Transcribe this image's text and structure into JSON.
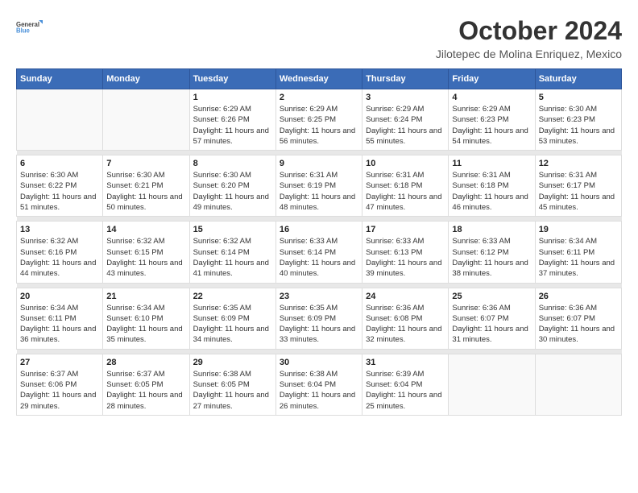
{
  "header": {
    "logo_line1": "General",
    "logo_line2": "Blue",
    "month_title": "October 2024",
    "location": "Jilotepec de Molina Enriquez, Mexico"
  },
  "weekdays": [
    "Sunday",
    "Monday",
    "Tuesday",
    "Wednesday",
    "Thursday",
    "Friday",
    "Saturday"
  ],
  "weeks": [
    [
      {
        "day": "",
        "sunrise": "",
        "sunset": "",
        "daylight": ""
      },
      {
        "day": "",
        "sunrise": "",
        "sunset": "",
        "daylight": ""
      },
      {
        "day": "1",
        "sunrise": "Sunrise: 6:29 AM",
        "sunset": "Sunset: 6:26 PM",
        "daylight": "Daylight: 11 hours and 57 minutes."
      },
      {
        "day": "2",
        "sunrise": "Sunrise: 6:29 AM",
        "sunset": "Sunset: 6:25 PM",
        "daylight": "Daylight: 11 hours and 56 minutes."
      },
      {
        "day": "3",
        "sunrise": "Sunrise: 6:29 AM",
        "sunset": "Sunset: 6:24 PM",
        "daylight": "Daylight: 11 hours and 55 minutes."
      },
      {
        "day": "4",
        "sunrise": "Sunrise: 6:29 AM",
        "sunset": "Sunset: 6:23 PM",
        "daylight": "Daylight: 11 hours and 54 minutes."
      },
      {
        "day": "5",
        "sunrise": "Sunrise: 6:30 AM",
        "sunset": "Sunset: 6:23 PM",
        "daylight": "Daylight: 11 hours and 53 minutes."
      }
    ],
    [
      {
        "day": "6",
        "sunrise": "Sunrise: 6:30 AM",
        "sunset": "Sunset: 6:22 PM",
        "daylight": "Daylight: 11 hours and 51 minutes."
      },
      {
        "day": "7",
        "sunrise": "Sunrise: 6:30 AM",
        "sunset": "Sunset: 6:21 PM",
        "daylight": "Daylight: 11 hours and 50 minutes."
      },
      {
        "day": "8",
        "sunrise": "Sunrise: 6:30 AM",
        "sunset": "Sunset: 6:20 PM",
        "daylight": "Daylight: 11 hours and 49 minutes."
      },
      {
        "day": "9",
        "sunrise": "Sunrise: 6:31 AM",
        "sunset": "Sunset: 6:19 PM",
        "daylight": "Daylight: 11 hours and 48 minutes."
      },
      {
        "day": "10",
        "sunrise": "Sunrise: 6:31 AM",
        "sunset": "Sunset: 6:18 PM",
        "daylight": "Daylight: 11 hours and 47 minutes."
      },
      {
        "day": "11",
        "sunrise": "Sunrise: 6:31 AM",
        "sunset": "Sunset: 6:18 PM",
        "daylight": "Daylight: 11 hours and 46 minutes."
      },
      {
        "day": "12",
        "sunrise": "Sunrise: 6:31 AM",
        "sunset": "Sunset: 6:17 PM",
        "daylight": "Daylight: 11 hours and 45 minutes."
      }
    ],
    [
      {
        "day": "13",
        "sunrise": "Sunrise: 6:32 AM",
        "sunset": "Sunset: 6:16 PM",
        "daylight": "Daylight: 11 hours and 44 minutes."
      },
      {
        "day": "14",
        "sunrise": "Sunrise: 6:32 AM",
        "sunset": "Sunset: 6:15 PM",
        "daylight": "Daylight: 11 hours and 43 minutes."
      },
      {
        "day": "15",
        "sunrise": "Sunrise: 6:32 AM",
        "sunset": "Sunset: 6:14 PM",
        "daylight": "Daylight: 11 hours and 41 minutes."
      },
      {
        "day": "16",
        "sunrise": "Sunrise: 6:33 AM",
        "sunset": "Sunset: 6:14 PM",
        "daylight": "Daylight: 11 hours and 40 minutes."
      },
      {
        "day": "17",
        "sunrise": "Sunrise: 6:33 AM",
        "sunset": "Sunset: 6:13 PM",
        "daylight": "Daylight: 11 hours and 39 minutes."
      },
      {
        "day": "18",
        "sunrise": "Sunrise: 6:33 AM",
        "sunset": "Sunset: 6:12 PM",
        "daylight": "Daylight: 11 hours and 38 minutes."
      },
      {
        "day": "19",
        "sunrise": "Sunrise: 6:34 AM",
        "sunset": "Sunset: 6:11 PM",
        "daylight": "Daylight: 11 hours and 37 minutes."
      }
    ],
    [
      {
        "day": "20",
        "sunrise": "Sunrise: 6:34 AM",
        "sunset": "Sunset: 6:11 PM",
        "daylight": "Daylight: 11 hours and 36 minutes."
      },
      {
        "day": "21",
        "sunrise": "Sunrise: 6:34 AM",
        "sunset": "Sunset: 6:10 PM",
        "daylight": "Daylight: 11 hours and 35 minutes."
      },
      {
        "day": "22",
        "sunrise": "Sunrise: 6:35 AM",
        "sunset": "Sunset: 6:09 PM",
        "daylight": "Daylight: 11 hours and 34 minutes."
      },
      {
        "day": "23",
        "sunrise": "Sunrise: 6:35 AM",
        "sunset": "Sunset: 6:09 PM",
        "daylight": "Daylight: 11 hours and 33 minutes."
      },
      {
        "day": "24",
        "sunrise": "Sunrise: 6:36 AM",
        "sunset": "Sunset: 6:08 PM",
        "daylight": "Daylight: 11 hours and 32 minutes."
      },
      {
        "day": "25",
        "sunrise": "Sunrise: 6:36 AM",
        "sunset": "Sunset: 6:07 PM",
        "daylight": "Daylight: 11 hours and 31 minutes."
      },
      {
        "day": "26",
        "sunrise": "Sunrise: 6:36 AM",
        "sunset": "Sunset: 6:07 PM",
        "daylight": "Daylight: 11 hours and 30 minutes."
      }
    ],
    [
      {
        "day": "27",
        "sunrise": "Sunrise: 6:37 AM",
        "sunset": "Sunset: 6:06 PM",
        "daylight": "Daylight: 11 hours and 29 minutes."
      },
      {
        "day": "28",
        "sunrise": "Sunrise: 6:37 AM",
        "sunset": "Sunset: 6:05 PM",
        "daylight": "Daylight: 11 hours and 28 minutes."
      },
      {
        "day": "29",
        "sunrise": "Sunrise: 6:38 AM",
        "sunset": "Sunset: 6:05 PM",
        "daylight": "Daylight: 11 hours and 27 minutes."
      },
      {
        "day": "30",
        "sunrise": "Sunrise: 6:38 AM",
        "sunset": "Sunset: 6:04 PM",
        "daylight": "Daylight: 11 hours and 26 minutes."
      },
      {
        "day": "31",
        "sunrise": "Sunrise: 6:39 AM",
        "sunset": "Sunset: 6:04 PM",
        "daylight": "Daylight: 11 hours and 25 minutes."
      },
      {
        "day": "",
        "sunrise": "",
        "sunset": "",
        "daylight": ""
      },
      {
        "day": "",
        "sunrise": "",
        "sunset": "",
        "daylight": ""
      }
    ]
  ]
}
